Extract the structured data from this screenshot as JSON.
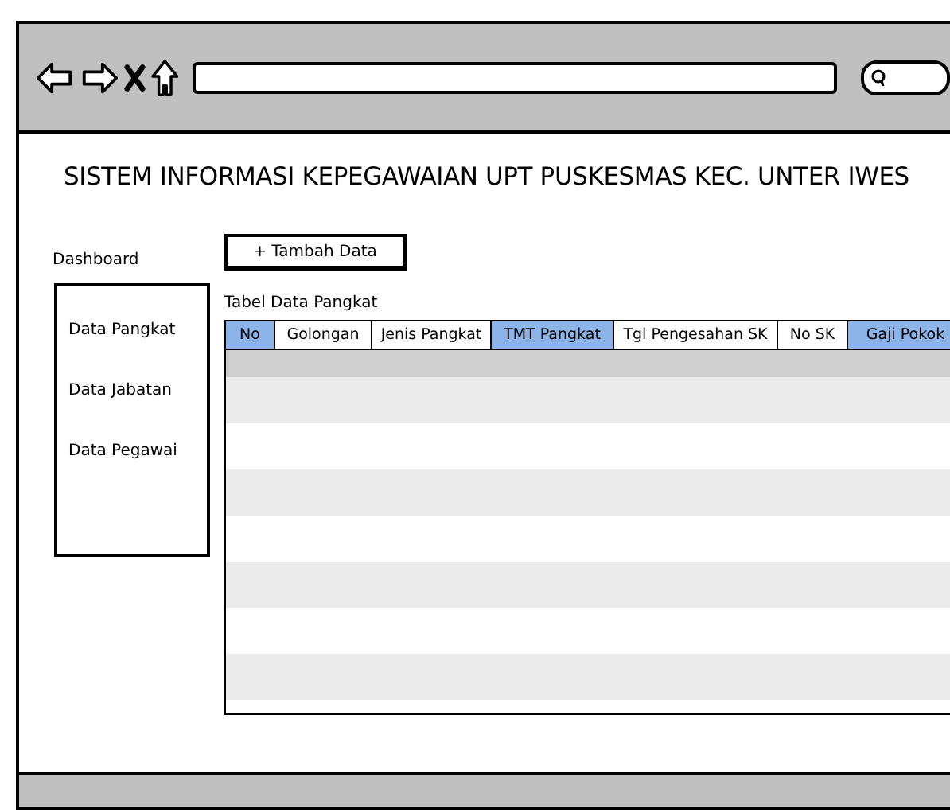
{
  "window": {
    "title": "SISTEM INFORMASI KEPEGAWAIAN UPT PUSKESMAS KEC. UNTER IWES"
  },
  "sidebar": {
    "heading": "Dashboard",
    "items": [
      {
        "label": "Data Pangkat"
      },
      {
        "label": "Data Jabatan"
      },
      {
        "label": "Data Pegawai"
      }
    ]
  },
  "add_button": "+ Tambah Data",
  "table": {
    "title": "Tabel Data Pangkat",
    "columns": [
      {
        "label": "No",
        "selected": true
      },
      {
        "label": "Golongan",
        "selected": false
      },
      {
        "label": "Jenis Pangkat",
        "selected": false
      },
      {
        "label": "TMT Pangkat",
        "selected": true
      },
      {
        "label": "Tgl Pengesahan SK",
        "selected": false
      },
      {
        "label": "No SK",
        "selected": false
      },
      {
        "label": "Gaji Pokok",
        "selected": true
      }
    ]
  }
}
